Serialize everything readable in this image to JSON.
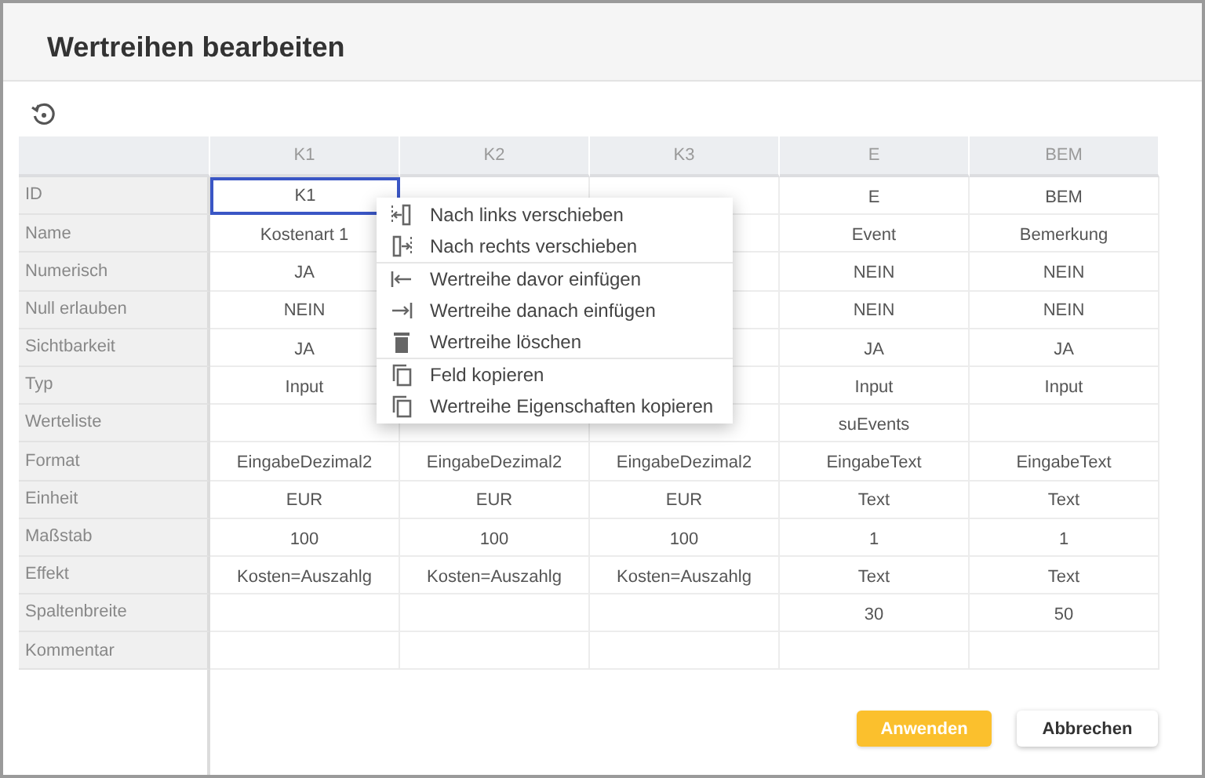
{
  "window": {
    "title": "Wertreihen bearbeiten"
  },
  "table": {
    "columns": [
      "K1",
      "K2",
      "K3",
      "E",
      "BEM"
    ],
    "rows": [
      {
        "label": "ID",
        "cells": [
          {
            "text": "K1",
            "selected": true
          },
          null,
          {
            "selected": false
          },
          {
            "text": "E",
            "selected": false
          },
          {
            "text": "BEM",
            "selected": false
          }
        ]
      },
      {
        "label": "Name",
        "cells": [
          {
            "text": "Kostenart 1",
            "selected": false
          },
          null,
          {
            "selected": false
          },
          {
            "text": "Event",
            "selected": false
          },
          {
            "text": "Bemerkung",
            "selected": false
          }
        ]
      },
      {
        "label": "Numerisch",
        "cells": [
          {
            "text": "JA",
            "selected": false
          },
          null,
          {
            "selected": false
          },
          {
            "text": "NEIN",
            "selected": false
          },
          {
            "text": "NEIN",
            "selected": false
          }
        ]
      },
      {
        "label": "Null erlauben",
        "cells": [
          {
            "text": "NEIN",
            "selected": false
          },
          null,
          {
            "selected": false
          },
          {
            "text": "NEIN",
            "selected": false
          },
          {
            "text": "NEIN",
            "selected": false
          }
        ]
      },
      {
        "label": "Sichtbarkeit",
        "cells": [
          {
            "text": "JA",
            "selected": false
          },
          null,
          {
            "selected": false
          },
          {
            "text": "JA",
            "selected": false
          },
          {
            "text": "JA",
            "selected": false
          }
        ]
      },
      {
        "label": "Typ",
        "cells": [
          {
            "text": "Input",
            "selected": false
          },
          null,
          {
            "selected": false
          },
          {
            "text": "Input",
            "selected": false
          },
          {
            "text": "Input",
            "selected": false
          }
        ]
      },
      {
        "label": "Werteliste",
        "cells": [
          {
            "selected": false
          },
          {
            "selected": false
          },
          {
            "selected": false
          },
          {
            "text": "suEvents",
            "selected": false
          },
          {
            "selected": false
          }
        ]
      },
      {
        "label": "Format",
        "cells": [
          {
            "text": "EingabeDezimal2",
            "selected": false
          },
          {
            "text": "EingabeDezimal2",
            "selected": false
          },
          {
            "text": "EingabeDezimal2",
            "selected": false
          },
          {
            "text": "EingabeText",
            "selected": false
          },
          {
            "text": "EingabeText",
            "selected": false
          }
        ]
      },
      {
        "label": "Einheit",
        "cells": [
          {
            "text": "EUR",
            "selected": false
          },
          {
            "text": "EUR",
            "selected": false
          },
          {
            "text": "EUR",
            "selected": false
          },
          {
            "text": "Text",
            "selected": false
          },
          {
            "text": "Text",
            "selected": false
          }
        ]
      },
      {
        "label": "Maßstab",
        "cells": [
          {
            "text": "100",
            "selected": false
          },
          {
            "text": "100",
            "selected": false
          },
          {
            "text": "100",
            "selected": false
          },
          {
            "text": "1",
            "selected": false
          },
          {
            "text": "1",
            "selected": false
          }
        ]
      },
      {
        "label": "Effekt",
        "cells": [
          {
            "text": "Kosten=Auszahlg",
            "selected": false
          },
          {
            "text": "Kosten=Auszahlg",
            "selected": false
          },
          {
            "text": "Kosten=Auszahlg",
            "selected": false
          },
          {
            "text": "Text",
            "selected": false
          },
          {
            "text": "Text",
            "selected": false
          }
        ]
      },
      {
        "label": "Spaltenbreite",
        "cells": [
          {
            "selected": false
          },
          {
            "selected": false
          },
          {
            "selected": false
          },
          {
            "text": "30",
            "selected": false
          },
          {
            "text": "50",
            "selected": false
          }
        ]
      },
      {
        "label": "Kommentar",
        "cells": [
          {
            "selected": false
          },
          {
            "selected": false
          },
          {
            "selected": false
          },
          {
            "selected": false
          },
          {
            "selected": false
          }
        ]
      }
    ]
  },
  "context_menu": {
    "groups": [
      [
        {
          "kind": "move-left",
          "label": "Nach links verschieben"
        },
        {
          "kind": "move-right",
          "label": "Nach rechts verschieben"
        }
      ],
      [
        {
          "kind": "insert-before",
          "label": "Wertreihe davor einfügen"
        },
        {
          "kind": "insert-after",
          "label": "Wertreihe danach einfügen"
        },
        {
          "kind": "delete",
          "label": "Wertreihe löschen"
        }
      ],
      [
        {
          "kind": "copy",
          "label": "Feld kopieren"
        },
        {
          "kind": "copy",
          "label": "Wertreihe Eigenschaften kopieren"
        }
      ]
    ]
  },
  "buttons": [
    {
      "kind": "primary",
      "label": "Anwenden"
    },
    {
      "kind": "secondary",
      "label": "Abbrechen"
    }
  ]
}
